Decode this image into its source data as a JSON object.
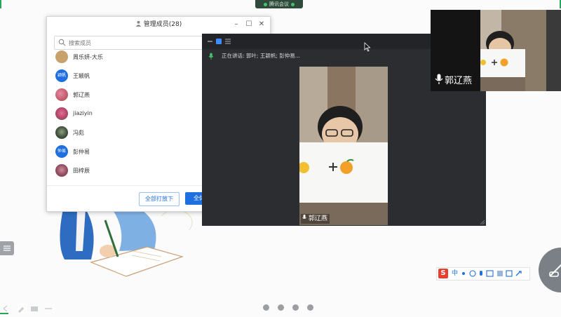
{
  "top_bar": {
    "label": "腾讯会议"
  },
  "member_panel": {
    "title": "管理成员(28)",
    "search_placeholder": "搜索成员",
    "members": [
      {
        "name": "周乐妍-大乐",
        "avatar_type": "photo",
        "avatar_color": "#c8a26a"
      },
      {
        "name": "王颖帆",
        "avatar_type": "initials",
        "avatar_text": "颖帆",
        "avatar_color": "#1e6fe0"
      },
      {
        "name": "郭辽燕",
        "avatar_type": "photo",
        "avatar_color": "#c45a6e"
      },
      {
        "name": "jiaziyin",
        "avatar_type": "photo",
        "avatar_color": "#b6456b"
      },
      {
        "name": "冯彪",
        "avatar_type": "photo",
        "avatar_color": "#3d4c3a"
      },
      {
        "name": "彭仲易",
        "avatar_type": "initials",
        "avatar_text": "仲易",
        "avatar_color": "#1e6fe0"
      },
      {
        "name": "田梓辰",
        "avatar_type": "photo",
        "avatar_color": "#8a4a5a"
      }
    ],
    "footer": {
      "unmute_all_label": "全部打放下",
      "mute_all_label": "全体"
    }
  },
  "video_window": {
    "speaking_text": "正在讲话: 郭叶; 王颖帆; 彭仲易...",
    "speaker_name": "郭辽燕"
  },
  "thumbnail": {
    "speaker_name": "郭辽燕"
  },
  "ime_toolbar": {
    "logo": "S",
    "mode": "中"
  },
  "page_dots": {
    "count": 4
  },
  "colors": {
    "accent_blue": "#1e6fe0",
    "meeting_green": "#47c26c",
    "edge_green": "#27a65a",
    "video_bg": "#2b2d31"
  }
}
